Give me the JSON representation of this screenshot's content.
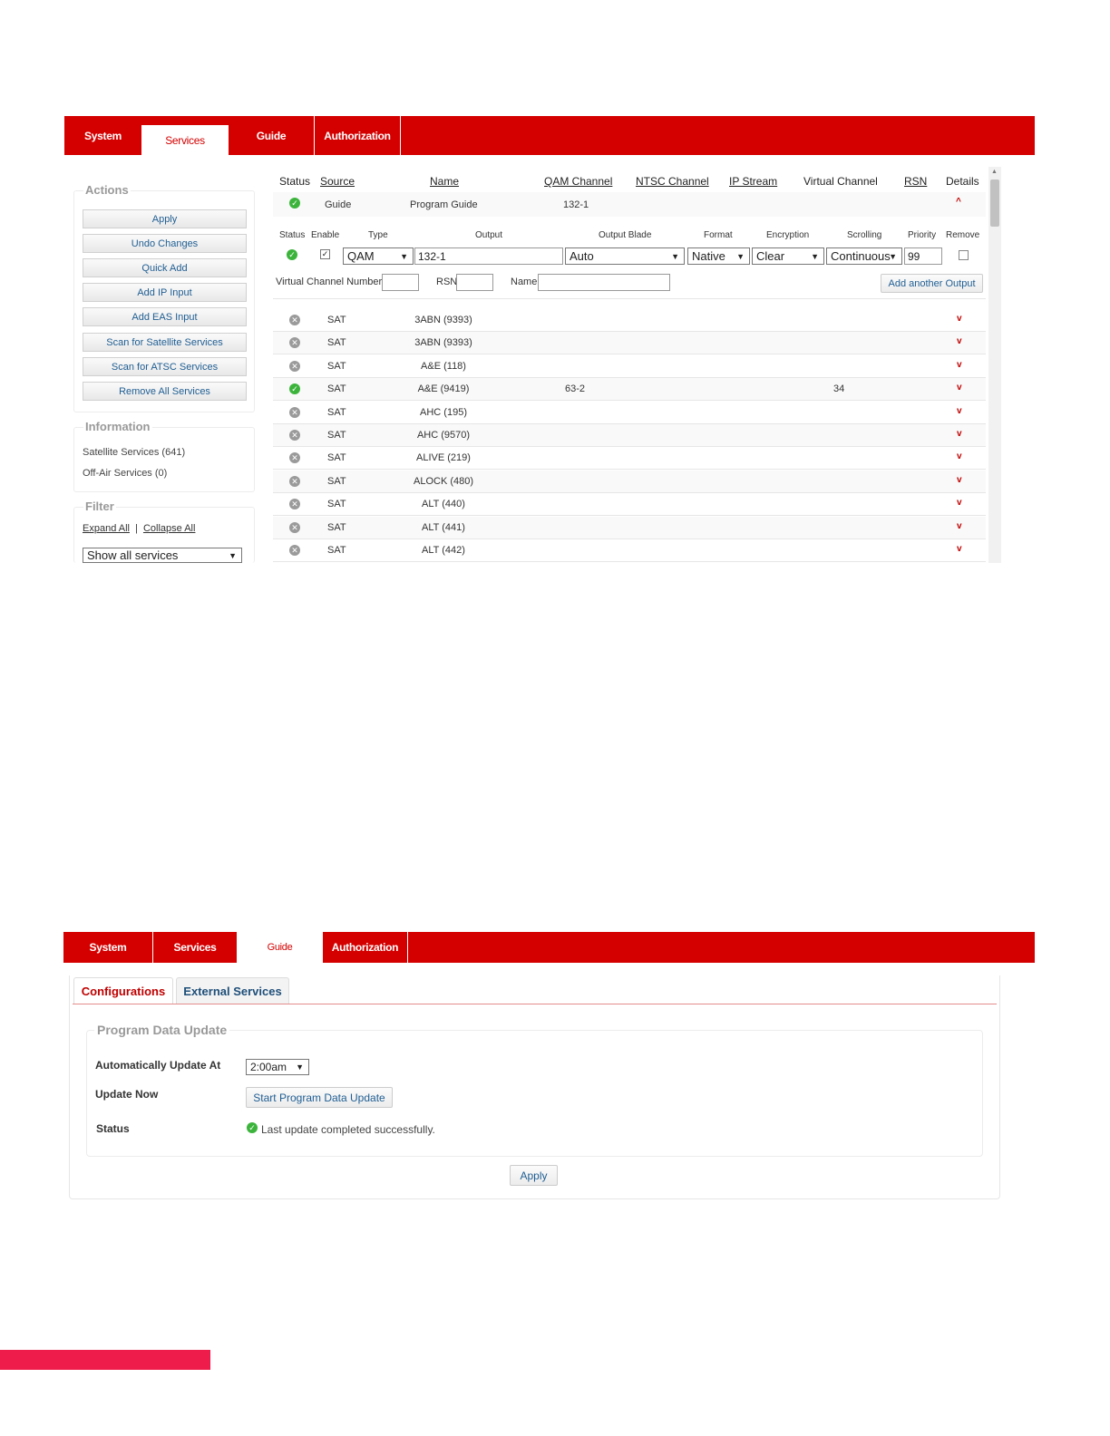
{
  "screen1": {
    "nav": [
      "System",
      "Services",
      "Guide",
      "Authorization"
    ],
    "actions": {
      "title": "Actions",
      "buttons": [
        "Apply",
        "Undo Changes",
        "Quick Add",
        "Add IP Input",
        "Add EAS Input",
        "Scan for Satellite Services",
        "Scan for ATSC Services",
        "Remove All Services"
      ]
    },
    "information": {
      "title": "Information",
      "lines": [
        "Satellite Services (641)",
        "Off-Air Services (0)"
      ]
    },
    "filter": {
      "title": "Filter",
      "expand_all": "Expand All",
      "separator": "|",
      "collapse_all": "Collapse All",
      "select_value": "Show all services"
    },
    "table": {
      "headers": [
        "Status",
        "Source",
        "Name",
        "QAM Channel",
        "NTSC Channel",
        "IP Stream",
        "Virtual Channel",
        "RSN",
        "Details"
      ],
      "expanded": {
        "source": "Guide",
        "name": "Program Guide",
        "qam": "132-1",
        "status": "ok"
      },
      "output_headers": [
        "Status",
        "Enable",
        "Type",
        "Output",
        "Output Blade",
        "Format",
        "Encryption",
        "Scrolling",
        "Priority",
        "Remove"
      ],
      "output_row": {
        "type": "QAM",
        "output": "132-1",
        "blade": "Auto",
        "format": "Native",
        "encryption": "Clear",
        "scrolling": "Continuous",
        "priority": "99"
      },
      "vc_label": "Virtual Channel Number",
      "rsn_label": "RSN",
      "name_label": "Name",
      "add_output": "Add another Output",
      "rows": [
        {
          "status": "x",
          "source": "SAT",
          "name": "3ABN (9393)",
          "qam": "",
          "vchan": ""
        },
        {
          "status": "x",
          "source": "SAT",
          "name": "3ABN (9393)",
          "qam": "",
          "vchan": ""
        },
        {
          "status": "x",
          "source": "SAT",
          "name": "A&E (118)",
          "qam": "",
          "vchan": ""
        },
        {
          "status": "ok",
          "source": "SAT",
          "name": "A&E (9419)",
          "qam": "63-2",
          "vchan": "34"
        },
        {
          "status": "x",
          "source": "SAT",
          "name": "AHC (195)",
          "qam": "",
          "vchan": ""
        },
        {
          "status": "x",
          "source": "SAT",
          "name": "AHC (9570)",
          "qam": "",
          "vchan": ""
        },
        {
          "status": "x",
          "source": "SAT",
          "name": "ALIVE (219)",
          "qam": "",
          "vchan": ""
        },
        {
          "status": "x",
          "source": "SAT",
          "name": "ALOCK (480)",
          "qam": "",
          "vchan": ""
        },
        {
          "status": "x",
          "source": "SAT",
          "name": "ALT (440)",
          "qam": "",
          "vchan": ""
        },
        {
          "status": "x",
          "source": "SAT",
          "name": "ALT (441)",
          "qam": "",
          "vchan": ""
        },
        {
          "status": "x",
          "source": "SAT",
          "name": "ALT (442)",
          "qam": "",
          "vchan": ""
        }
      ]
    }
  },
  "screen2": {
    "nav": [
      "System",
      "Services",
      "Guide",
      "Authorization"
    ],
    "tabs": [
      "Configurations",
      "External Services"
    ],
    "section_title": "Program Data Update",
    "auto_label": "Automatically Update At",
    "auto_value": "2:00am",
    "update_label": "Update Now",
    "update_button": "Start Program Data Update",
    "status_label": "Status",
    "status_text": "Last update completed successfully.",
    "apply": "Apply"
  },
  "colors": {
    "brand_red": "#d40000",
    "footer_pink": "#ee1c4a",
    "ok_green": "#3cb43c"
  }
}
